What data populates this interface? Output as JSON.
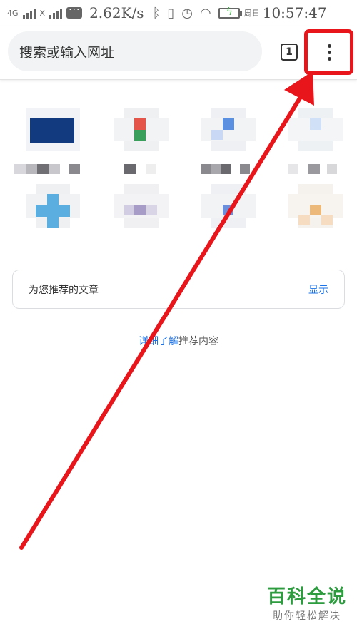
{
  "status_bar": {
    "network_left": "4G",
    "network_right": "X",
    "speed": "2.62K/s",
    "day": "周日",
    "time": "10:57:47",
    "battery_color": "#3cb043"
  },
  "toolbar": {
    "omnibox_placeholder": "搜索或输入网址",
    "tab_count": "1",
    "menu_icon": "more-vert-icon",
    "highlight_color": "#e8151b"
  },
  "recommended": {
    "title": "为您推荐的文章",
    "show_label": "显示",
    "learn_more_link": "详细了解",
    "learn_more_rest": "推荐内容"
  },
  "annotation": {
    "arrow_color": "#e8151b"
  },
  "watermark": {
    "main": "百科全说",
    "sub": "助你轻松解决"
  }
}
